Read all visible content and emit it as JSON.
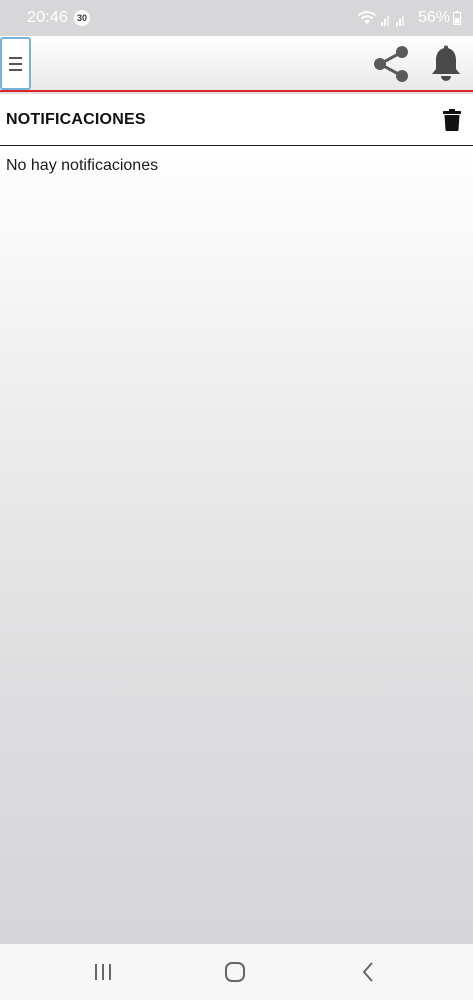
{
  "status_bar": {
    "time": "20:46",
    "badge": "30",
    "battery": "56%"
  },
  "icons": {
    "menu": "hamburger-menu-icon",
    "share": "share-icon",
    "bell": "bell-icon",
    "trash": "trash-icon",
    "wifi": "wifi-icon",
    "signal": "signal-icon",
    "battery": "battery-icon",
    "nav_recent": "recent-apps-icon",
    "nav_home": "home-icon",
    "nav_back": "back-icon"
  },
  "colors": {
    "accent_red": "#d8262a",
    "menu_border": "#74b4d9",
    "icon_gray": "#555555"
  },
  "notifications": {
    "title": "NOTIFICACIONES",
    "empty_message": "No hay notificaciones"
  }
}
